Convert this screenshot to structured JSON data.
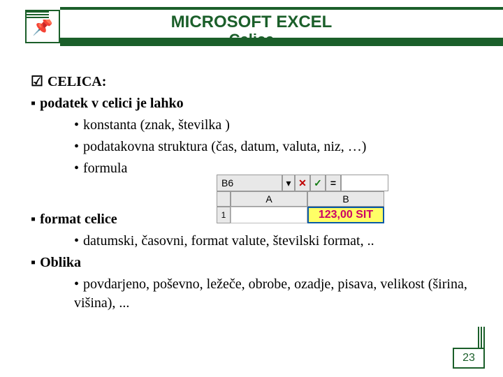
{
  "header": {
    "title1": "MICROSOFT EXCEL",
    "title2": "Celica"
  },
  "bullets": {
    "celica": "CELICA:",
    "podatek": "podatek v celici je lahko",
    "sub1": "konstanta (znak, številka )",
    "sub2": "podatakovna struktura (čas, datum, valuta, niz, …)",
    "sub3": "formula",
    "format": "format celice",
    "sub4": "datumski, časovni, format valute, številski format, ..",
    "oblika": "Oblika",
    "sub5": "povdarjeno, poševno, ležeče, obrobe, ozadje, pisava, velikost (širina, višina), ..."
  },
  "glyphs": {
    "check": "☑",
    "square": "▪",
    "bullet": "•",
    "dd": "▾",
    "x": "✕",
    "v": "✓",
    "eq": "="
  },
  "formulabar": {
    "name": "B6",
    "colA": "A",
    "colB": "B",
    "row": "1",
    "value": "123,00 SIT"
  },
  "page": "23"
}
